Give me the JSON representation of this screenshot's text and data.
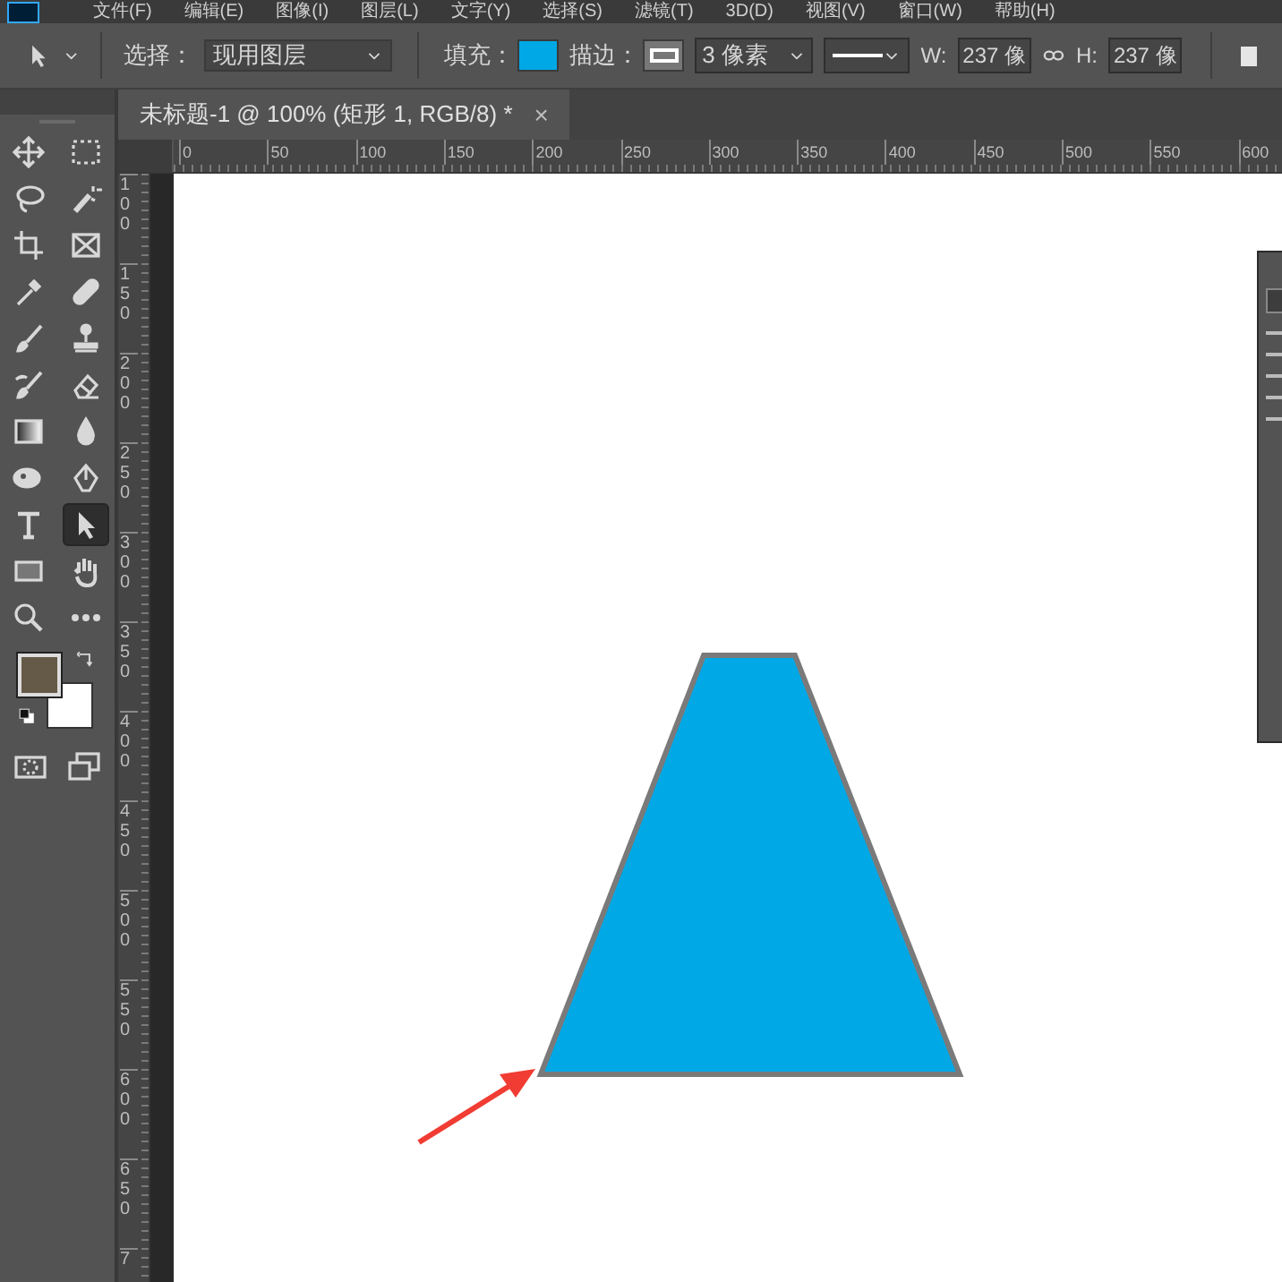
{
  "menu": [
    "文件(F)",
    "编辑(E)",
    "图像(I)",
    "图层(L)",
    "文字(Y)",
    "选择(S)",
    "滤镜(T)",
    "3D(D)",
    "视图(V)",
    "窗口(W)",
    "帮助(H)"
  ],
  "options": {
    "select_label": "选择：",
    "select_value": "现用图层",
    "fill_label": "填充：",
    "stroke_label": "描边：",
    "stroke_width": "3 像素",
    "w_label": "W:",
    "w_value": "237 像",
    "h_label": "H:",
    "h_value": "237 像"
  },
  "tab": {
    "title": "未标题-1 @ 100% (矩形 1, RGB/8) *",
    "close": "×"
  },
  "tools": [
    {
      "kind": "move",
      "selected": false
    },
    {
      "kind": "marquee",
      "selected": false
    },
    {
      "kind": "lasso",
      "selected": false
    },
    {
      "kind": "wand",
      "selected": false
    },
    {
      "kind": "crop",
      "selected": false
    },
    {
      "kind": "frame",
      "selected": false
    },
    {
      "kind": "eyedropper",
      "selected": false
    },
    {
      "kind": "healing",
      "selected": false
    },
    {
      "kind": "brush",
      "selected": false
    },
    {
      "kind": "stamp",
      "selected": false
    },
    {
      "kind": "history",
      "selected": false
    },
    {
      "kind": "eraser",
      "selected": false
    },
    {
      "kind": "gradient",
      "selected": false
    },
    {
      "kind": "blur",
      "selected": false
    },
    {
      "kind": "dodge",
      "selected": false
    },
    {
      "kind": "pen",
      "selected": false
    },
    {
      "kind": "type",
      "selected": false
    },
    {
      "kind": "direct",
      "selected": true
    },
    {
      "kind": "rectangle",
      "selected": false
    },
    {
      "kind": "hand",
      "selected": false
    },
    {
      "kind": "zoom",
      "selected": false
    },
    {
      "kind": "more",
      "selected": false
    }
  ],
  "hruler": [
    "0",
    "50",
    "100",
    "150",
    "200",
    "250",
    "300",
    "350",
    "400",
    "450",
    "500",
    "550",
    "600"
  ],
  "vruler": [
    "100",
    "150",
    "200",
    "250",
    "300",
    "350",
    "400",
    "450",
    "500",
    "550",
    "600",
    "650",
    "7"
  ]
}
